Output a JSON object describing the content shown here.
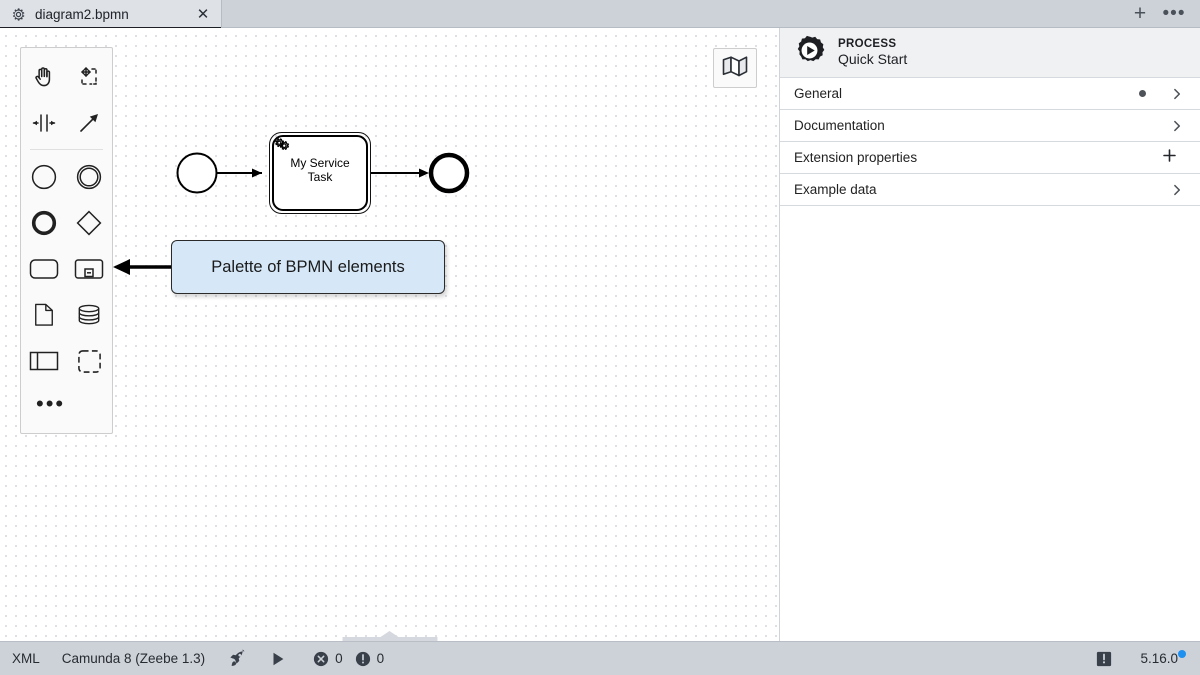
{
  "tabbar": {
    "tabs": [
      {
        "title": "diagram2.bpmn",
        "icon": "gear-icon",
        "close_label": "✕",
        "active": true
      }
    ],
    "add_tab_label": "+",
    "more_label": "•••"
  },
  "palette": {
    "tools": [
      {
        "name": "hand-tool",
        "label": "Activate hand tool"
      },
      {
        "name": "lasso-tool",
        "label": "Activate lasso tool"
      },
      {
        "name": "space-tool",
        "label": "Activate create/remove space tool"
      },
      {
        "name": "global-connect-tool",
        "label": "Activate global connect tool"
      }
    ],
    "elements": [
      {
        "name": "start-event",
        "label": "Create start event"
      },
      {
        "name": "intermediate-event",
        "label": "Create intermediate/boundary event"
      },
      {
        "name": "end-event",
        "label": "Create end event"
      },
      {
        "name": "gateway",
        "label": "Create gateway"
      },
      {
        "name": "task",
        "label": "Create task"
      },
      {
        "name": "subprocess-collapsed",
        "label": "Create collapsed subprocess"
      },
      {
        "name": "data-object",
        "label": "Create data object reference"
      },
      {
        "name": "data-store",
        "label": "Create data store reference"
      },
      {
        "name": "participant",
        "label": "Create pool/participant"
      },
      {
        "name": "group",
        "label": "Create group"
      }
    ],
    "more_label": "•••"
  },
  "canvas": {
    "minimap_icon": "map-icon",
    "callout": {
      "text": "Palette of BPMN elements"
    },
    "diagram": {
      "start_event": {
        "name": "start-event-shape",
        "label": ""
      },
      "service_task": {
        "name": "service-task-shape",
        "label": "My Service\nTask",
        "label_line1": "My Service",
        "label_line2": "Task",
        "icon": "service-task-gear-icon",
        "selected": true
      },
      "end_event": {
        "name": "end-event-shape",
        "label": ""
      },
      "flows": [
        {
          "name": "sequence-flow-1",
          "from": "start-event",
          "to": "service-task"
        },
        {
          "name": "sequence-flow-2",
          "from": "service-task",
          "to": "end-event"
        }
      ]
    },
    "drawer_handle": {
      "name": "bottom-panel-handle"
    }
  },
  "panel": {
    "header": {
      "icon": "process-gear-play-icon",
      "kind": "PROCESS",
      "name": "Quick Start"
    },
    "groups": [
      {
        "label": "General",
        "has_dot": true,
        "action": "chevron-right-icon"
      },
      {
        "label": "Documentation",
        "has_dot": false,
        "action": "chevron-right-icon"
      },
      {
        "label": "Extension properties",
        "has_dot": false,
        "action": "plus-icon"
      },
      {
        "label": "Example data",
        "has_dot": false,
        "action": "chevron-right-icon"
      }
    ]
  },
  "statusbar": {
    "xml_label": "XML",
    "engine_label": "Camunda 8 (Zeebe 1.3)",
    "deploy_icon": "rocket-icon",
    "run_icon": "play-icon",
    "error_icon": "error-icon",
    "error_count": "0",
    "warning_icon": "warning-icon",
    "warning_count": "0",
    "notification_icon": "notification-icon",
    "version": "5.16.0"
  },
  "colors": {
    "accent_blue": "#1e90f0",
    "callout_bg": "#d6e8f8",
    "chrome_bg": "#cdd2d9",
    "panel_header_bg": "#f0f1f3"
  }
}
